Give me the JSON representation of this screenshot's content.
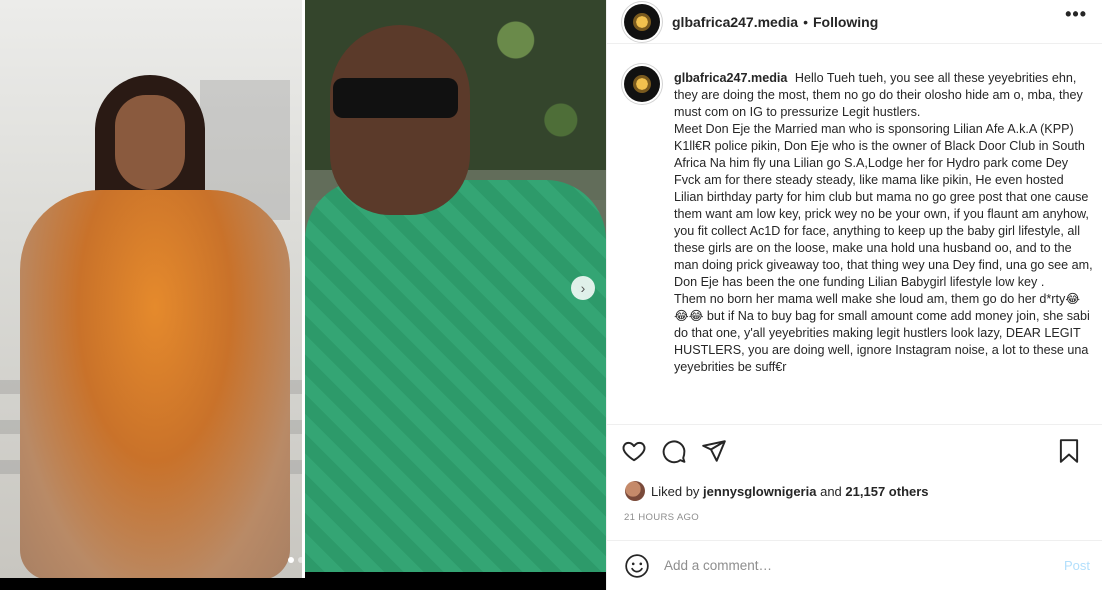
{
  "post": {
    "username": "glbafrica247.media",
    "separator": "•",
    "follow_state": "Following",
    "more_label": "•••"
  },
  "caption": {
    "username": "glbafrica247.media",
    "paragraph_1": "Hello Tueh tueh, you see all these yeyebrities ehn, they are doing the most, them no go do their olosho hide am o, mba, they must com on IG to pressurize Legit hustlers.",
    "paragraph_2": "Meet Don Eje the Married man who is sponsoring Lilian Afe A.k.A (KPP) K1ll€R police pikin, Don Eje who is the owner of Black Door Club in South Africa Na him fly una Lilian go S.A,Lodge her for Hydro park come Dey Fvck am for there steady steady, like mama like pikin, He even hosted Lilian birthday party for him club but mama no go gree post that one cause them want am low key, prick wey no be your own, if you flaunt am anyhow, you fit collect Ac1D for face, anything to keep up the baby girl lifestyle, all these girls are on the loose, make una hold una husband oo, and to the man doing prick giveaway too, that thing wey una Dey find, una go see am, Don Eje has been the one funding Lilian Babygirl lifestyle low key .",
    "paragraph_3": "Them no born her mama well make she loud am, them go do her d*rty😂😂😂 but if Na to buy bag for small amount come add money join, she sabi do that one, y'all yeyebrities making legit hustlers look lazy, DEAR LEGIT HUSTLERS, you are doing well, ignore Instagram noise, a lot to these una yeyebrities be suff€r"
  },
  "likes": {
    "prefix": "Liked by",
    "user": "jennysglownigeria",
    "middle": "and",
    "others": "21,157 others"
  },
  "timestamp": "21 HOURS AGO",
  "comment": {
    "placeholder": "Add a comment…",
    "post_label": "Post"
  },
  "carousel": {
    "next_label": "›",
    "slides": 2,
    "active": 1
  },
  "icons": {
    "like": "heart-icon",
    "comment": "comment-bubble-icon",
    "share": "paper-plane-icon",
    "save": "bookmark-icon",
    "emoji": "smiley-icon",
    "next": "chevron-right-icon"
  },
  "colors": {
    "link_disabled": "#b2dffc",
    "muted": "#8e8e8e",
    "text": "#262626",
    "border": "#efefef"
  }
}
